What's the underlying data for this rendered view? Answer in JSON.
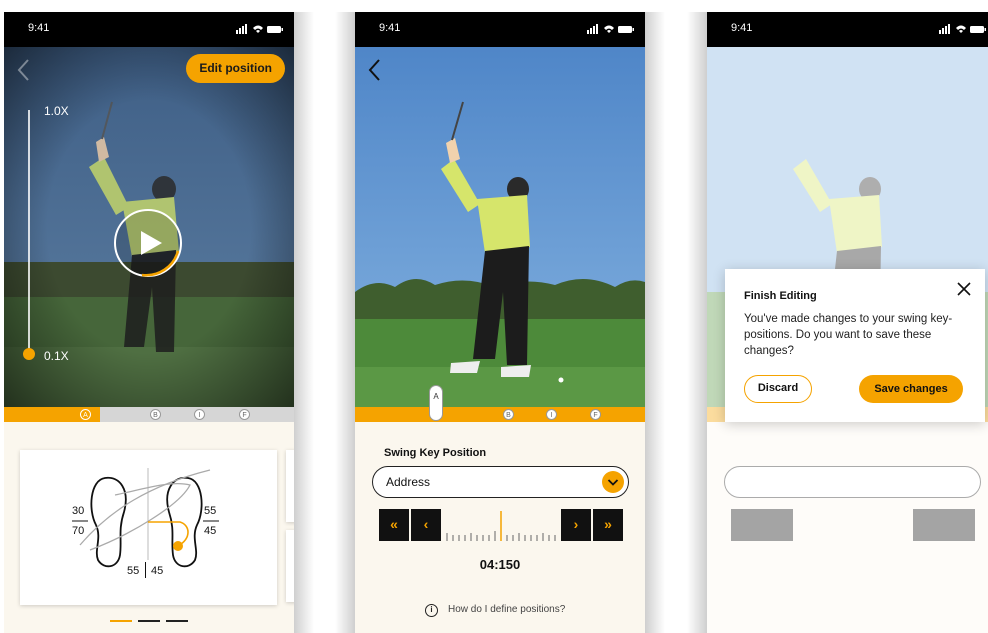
{
  "status_bar": {
    "time": "9:41"
  },
  "screen_playback": {
    "edit_label": "Edit position",
    "speed_max": "1.0X",
    "speed_min": "0.1X",
    "timeline_markers": [
      "A",
      "B",
      "I",
      "F"
    ],
    "pressure": {
      "left_top": "30",
      "left_bottom": "70",
      "right_top": "55",
      "right_bottom": "45",
      "bottom_left": "55",
      "bottom_right": "45"
    }
  },
  "screen_edit": {
    "timeline_markers": [
      "A",
      "B",
      "I",
      "F"
    ],
    "section_title": "Swing Key Position",
    "selected_position": "Address",
    "buttons": {
      "rewind_fast": "«",
      "rewind": "‹",
      "forward": "›",
      "forward_fast": "»"
    },
    "frame_value": "04:150",
    "help_text": "How do I define positions?"
  },
  "dialog": {
    "title": "Finish Editing",
    "body": "You've made changes to your swing key-positions. Do you want to save these changes?",
    "discard_label": "Discard",
    "save_label": "Save changes"
  },
  "colors": {
    "accent": "#f5a300",
    "status_bar": "#000000"
  }
}
